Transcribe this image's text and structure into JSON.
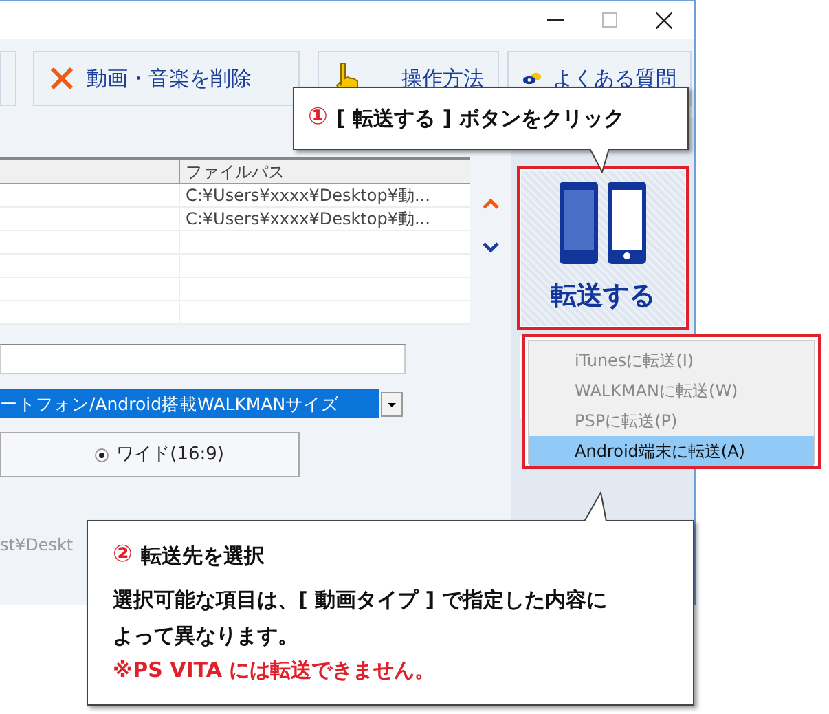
{
  "toolbar": [
    {
      "kind": "delete",
      "label": "動画・音楽を削除"
    },
    {
      "kind": "help",
      "label": "操作方法"
    },
    {
      "kind": "faq",
      "label": "よくある質問"
    }
  ],
  "table": {
    "column_2": "ファイルパス",
    "rows": [
      {
        "file_path": "C:¥Users¥xxxx¥Desktop¥動..."
      },
      {
        "file_path": "C:¥Users¥xxxx¥Desktop¥動..."
      }
    ]
  },
  "transfer_button": {
    "label": "転送する"
  },
  "transfer_menu": [
    {
      "label": "iTunesに転送(I)",
      "disabled": true,
      "selected": false
    },
    {
      "label": "WALKMANに転送(W)",
      "disabled": true,
      "selected": false
    },
    {
      "label": "PSPに転送(P)",
      "disabled": true,
      "selected": false
    },
    {
      "label": "Android端末に転送(A)",
      "disabled": false,
      "selected": true
    }
  ],
  "size_select": {
    "value": "ートフォン/Android搭載WALKMANサイズ"
  },
  "aspect_radio": {
    "label": "ワイド(16:9)",
    "selected": true
  },
  "status_path": "st¥Deskt",
  "callouts": [
    {
      "number": "①",
      "title": "[ 転送する ] ボタンをクリック"
    },
    {
      "number": "②",
      "title": "転送先を選択",
      "body": "選択可能な項目は、[ 動画タイプ ] で指定した内容によって異なります。",
      "note": "※PS VITA には転送できません。"
    }
  ]
}
